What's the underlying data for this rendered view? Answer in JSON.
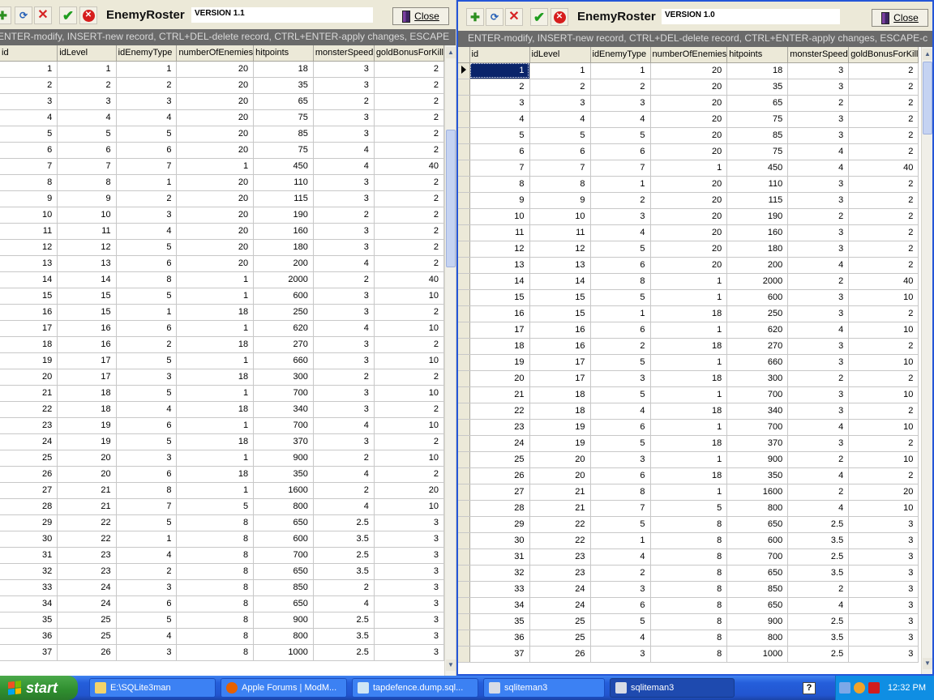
{
  "left_window": {
    "title": "EnemyRoster",
    "version": "VERSION 1.1",
    "close_label": "Close",
    "hint": "ENTER-modify, INSERT-new record, CTRL+DEL-delete record, CTRL+ENTER-apply changes, ESCAPE"
  },
  "right_window": {
    "title": "EnemyRoster",
    "version": "VERSION 1.0",
    "close_label": "Close",
    "hint": "ENTER-modify, INSERT-new record, CTRL+DEL-delete record, CTRL+ENTER-apply changes, ESCAPE-c"
  },
  "table": {
    "columns": [
      "id",
      "idLevel",
      "idEnemyType",
      "numberOfEnemies",
      "hitpoints",
      "monsterSpeed",
      "goldBonusForKill"
    ],
    "rows": [
      [
        "1",
        "1",
        "1",
        "20",
        "18",
        "3",
        "2"
      ],
      [
        "2",
        "2",
        "2",
        "20",
        "35",
        "3",
        "2"
      ],
      [
        "3",
        "3",
        "3",
        "20",
        "65",
        "2",
        "2"
      ],
      [
        "4",
        "4",
        "4",
        "20",
        "75",
        "3",
        "2"
      ],
      [
        "5",
        "5",
        "5",
        "20",
        "85",
        "3",
        "2"
      ],
      [
        "6",
        "6",
        "6",
        "20",
        "75",
        "4",
        "2"
      ],
      [
        "7",
        "7",
        "7",
        "1",
        "450",
        "4",
        "40"
      ],
      [
        "8",
        "8",
        "1",
        "20",
        "110",
        "3",
        "2"
      ],
      [
        "9",
        "9",
        "2",
        "20",
        "115",
        "3",
        "2"
      ],
      [
        "10",
        "10",
        "3",
        "20",
        "190",
        "2",
        "2"
      ],
      [
        "11",
        "11",
        "4",
        "20",
        "160",
        "3",
        "2"
      ],
      [
        "12",
        "12",
        "5",
        "20",
        "180",
        "3",
        "2"
      ],
      [
        "13",
        "13",
        "6",
        "20",
        "200",
        "4",
        "2"
      ],
      [
        "14",
        "14",
        "8",
        "1",
        "2000",
        "2",
        "40"
      ],
      [
        "15",
        "15",
        "5",
        "1",
        "600",
        "3",
        "10"
      ],
      [
        "16",
        "15",
        "1",
        "18",
        "250",
        "3",
        "2"
      ],
      [
        "17",
        "16",
        "6",
        "1",
        "620",
        "4",
        "10"
      ],
      [
        "18",
        "16",
        "2",
        "18",
        "270",
        "3",
        "2"
      ],
      [
        "19",
        "17",
        "5",
        "1",
        "660",
        "3",
        "10"
      ],
      [
        "20",
        "17",
        "3",
        "18",
        "300",
        "2",
        "2"
      ],
      [
        "21",
        "18",
        "5",
        "1",
        "700",
        "3",
        "10"
      ],
      [
        "22",
        "18",
        "4",
        "18",
        "340",
        "3",
        "2"
      ],
      [
        "23",
        "19",
        "6",
        "1",
        "700",
        "4",
        "10"
      ],
      [
        "24",
        "19",
        "5",
        "18",
        "370",
        "3",
        "2"
      ],
      [
        "25",
        "20",
        "3",
        "1",
        "900",
        "2",
        "10"
      ],
      [
        "26",
        "20",
        "6",
        "18",
        "350",
        "4",
        "2"
      ],
      [
        "27",
        "21",
        "8",
        "1",
        "1600",
        "2",
        "20"
      ],
      [
        "28",
        "21",
        "7",
        "5",
        "800",
        "4",
        "10"
      ],
      [
        "29",
        "22",
        "5",
        "8",
        "650",
        "2.5",
        "3"
      ],
      [
        "30",
        "22",
        "1",
        "8",
        "600",
        "3.5",
        "3"
      ],
      [
        "31",
        "23",
        "4",
        "8",
        "700",
        "2.5",
        "3"
      ],
      [
        "32",
        "23",
        "2",
        "8",
        "650",
        "3.5",
        "3"
      ],
      [
        "33",
        "24",
        "3",
        "8",
        "850",
        "2",
        "3"
      ],
      [
        "34",
        "24",
        "6",
        "8",
        "650",
        "4",
        "3"
      ],
      [
        "35",
        "25",
        "5",
        "8",
        "900",
        "2.5",
        "3"
      ],
      [
        "36",
        "25",
        "4",
        "8",
        "800",
        "3.5",
        "3"
      ],
      [
        "37",
        "26",
        "3",
        "8",
        "1000",
        "2.5",
        "3"
      ]
    ]
  },
  "taskbar": {
    "start_label": "start",
    "tasks": [
      {
        "label": "E:\\SQLite3man",
        "icon": "folder-icon"
      },
      {
        "label": "Apple Forums | ModM...",
        "icon": "firefox-icon"
      },
      {
        "label": "tapdefence.dump.sql...",
        "icon": "notepad-icon"
      },
      {
        "label": "sqliteman3",
        "icon": "sqliteman-icon"
      },
      {
        "label": "sqliteman3",
        "icon": "sqliteman-icon"
      }
    ],
    "clock": "12:32 PM",
    "help_label": "?"
  },
  "colors": {
    "taskbar": "#245edb",
    "start": "#2f8e2f",
    "hint_bar": "#6a6a6a",
    "active_cell": "#0a246a",
    "active_window_border": "#2456d8"
  }
}
